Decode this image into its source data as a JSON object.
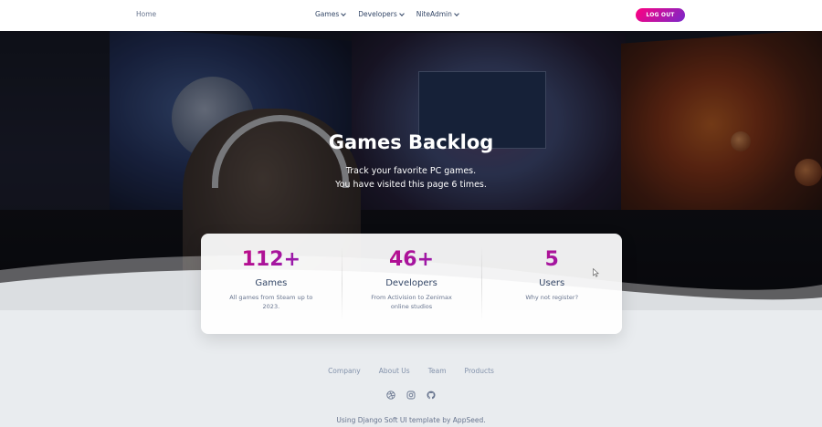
{
  "navbar": {
    "home_label": "Home",
    "menu": [
      {
        "label": "Games"
      },
      {
        "label": "Developers"
      },
      {
        "label": "NiteAdmin"
      }
    ],
    "logout_label": "LOG OUT"
  },
  "hero": {
    "title": "Games Backlog",
    "subtitle_line1": "Track your favorite PC games.",
    "subtitle_line2": "You have visited this page 6 times."
  },
  "stats": [
    {
      "value": "112+",
      "title": "Games",
      "description": "All games from Steam up to 2023."
    },
    {
      "value": "46+",
      "title": "Developers",
      "description": "From Activision to Zenimax online studios"
    },
    {
      "value": "5",
      "title": "Users",
      "description": "Why not register?"
    }
  ],
  "footer": {
    "links": [
      "Company",
      "About Us",
      "Team",
      "Products"
    ],
    "social_icons": [
      "dribbble-icon",
      "instagram-icon",
      "github-icon"
    ],
    "copyright": "Using Django Soft UI template by AppSeed."
  },
  "colors": {
    "accent_gradient_start": "#7928ca",
    "accent_gradient_end": "#ff0080",
    "page_background": "#e9ecef",
    "text_dark": "#344767",
    "text_muted": "#67748e"
  }
}
